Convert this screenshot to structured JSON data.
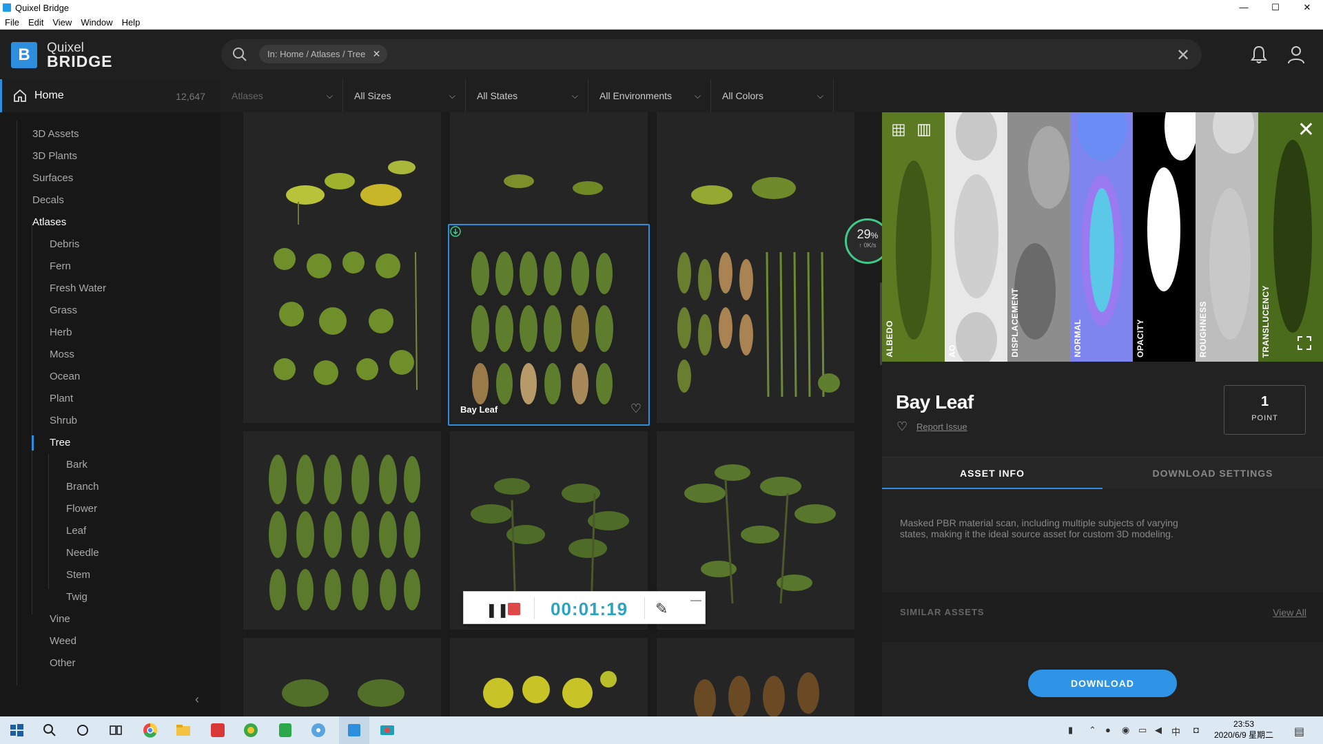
{
  "window": {
    "title": "Quixel Bridge",
    "controls": [
      "—",
      "☐",
      "✕"
    ]
  },
  "menu": [
    "File",
    "Edit",
    "View",
    "Window",
    "Help"
  ],
  "brand": {
    "logo_letter": "B",
    "line1": "Quixel",
    "line2": "BRIDGE"
  },
  "search": {
    "chip": "In: Home / Atlases / Tree",
    "chip_close": "✕",
    "clear": "✕"
  },
  "sidebar": {
    "home_label": "Home",
    "home_count": "12,647",
    "top_items": [
      "3D Assets",
      "3D Plants",
      "Surfaces",
      "Decals",
      "Atlases"
    ],
    "atlas_items": [
      "Debris",
      "Fern",
      "Fresh Water",
      "Grass",
      "Herb",
      "Moss",
      "Ocean",
      "Plant",
      "Shrub",
      "Tree"
    ],
    "tree_items": [
      "Bark",
      "Branch",
      "Flower",
      "Leaf",
      "Needle",
      "Stem",
      "Twig"
    ],
    "after_items": [
      "Vine",
      "Weed",
      "Other"
    ],
    "collapse": "‹"
  },
  "filters": [
    {
      "label": "Atlases",
      "disabled": true
    },
    {
      "label": "All Sizes",
      "disabled": false
    },
    {
      "label": "All States",
      "disabled": false
    },
    {
      "label": "All Environments",
      "disabled": false
    },
    {
      "label": "All Colors",
      "disabled": false
    }
  ],
  "grid": {
    "selected_title": "Bay Leaf",
    "heart": "♡"
  },
  "progress": {
    "percent": "29",
    "percent_sign": "%",
    "speed": "↑ 0K/s"
  },
  "recorder": {
    "pause": "❚❚",
    "time": "00:01:19",
    "pen": "✎",
    "minimize": "—"
  },
  "panel": {
    "maps": [
      {
        "label": "ALBEDO",
        "color": "#4b6a1e"
      },
      {
        "label": "AO",
        "color": "#d8d8d8"
      },
      {
        "label": "DISPLACEMENT",
        "color": "#8a8a8a"
      },
      {
        "label": "NORMAL",
        "color": "#7e86f0"
      },
      {
        "label": "OPACITY",
        "color": "#000000"
      },
      {
        "label": "ROUGHNESS",
        "color": "#b8b8b8"
      },
      {
        "label": "TRANSLUCENCY",
        "color": "#3e5a1a"
      }
    ],
    "close": "✕",
    "title": "Bay Leaf",
    "heart": "♡",
    "report": "Report Issue",
    "points_value": "1",
    "points_label": "POINT",
    "tabs": [
      "ASSET INFO",
      "DOWNLOAD SETTINGS"
    ],
    "description": "Masked PBR material scan, including multiple subjects of varying states, making it the ideal source asset for custom 3D modeling.",
    "similar": "SIMILAR ASSETS",
    "view_all": "View All",
    "download": "DOWNLOAD"
  },
  "taskbar": {
    "time": "23:53",
    "date": "2020/6/9 星期二"
  },
  "colors": {
    "accent": "#2d8ede",
    "progress": "#3ecb8a",
    "download": "#2f94e6"
  }
}
